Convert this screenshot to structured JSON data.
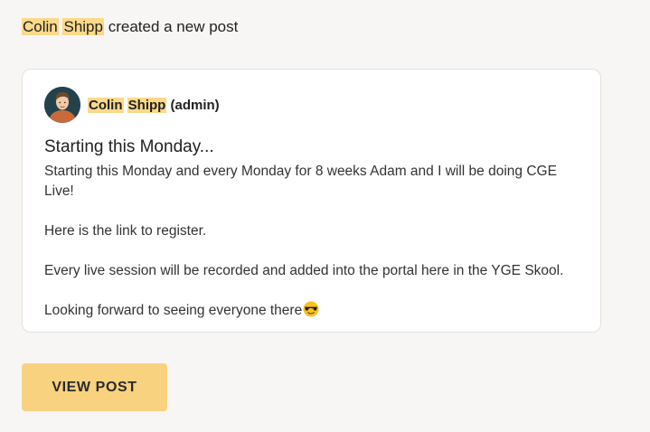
{
  "notification": {
    "first_name": "Colin",
    "last_name": "Shipp",
    "action_text": "created a new post"
  },
  "post": {
    "author_first_name": "Colin",
    "author_last_name": "Shipp",
    "author_role": "(admin)",
    "avatar_icon": "user-avatar",
    "title": "Starting this Monday...",
    "paragraphs": [
      "Starting this Monday and every Monday for 8 weeks Adam and I will be doing CGE Live!",
      "Here is the link to register.",
      "Every live session will be recorded and added into the portal here in the YGE Skool.",
      "Looking forward to seeing everyone there"
    ],
    "end_emoji": "sunglasses-emoji"
  },
  "actions": {
    "view_post_label": "VIEW POST"
  },
  "colors": {
    "highlight": "#fbd98a",
    "button": "#f8d27f",
    "page_background": "#f7f6f4",
    "card_background": "#ffffff"
  }
}
